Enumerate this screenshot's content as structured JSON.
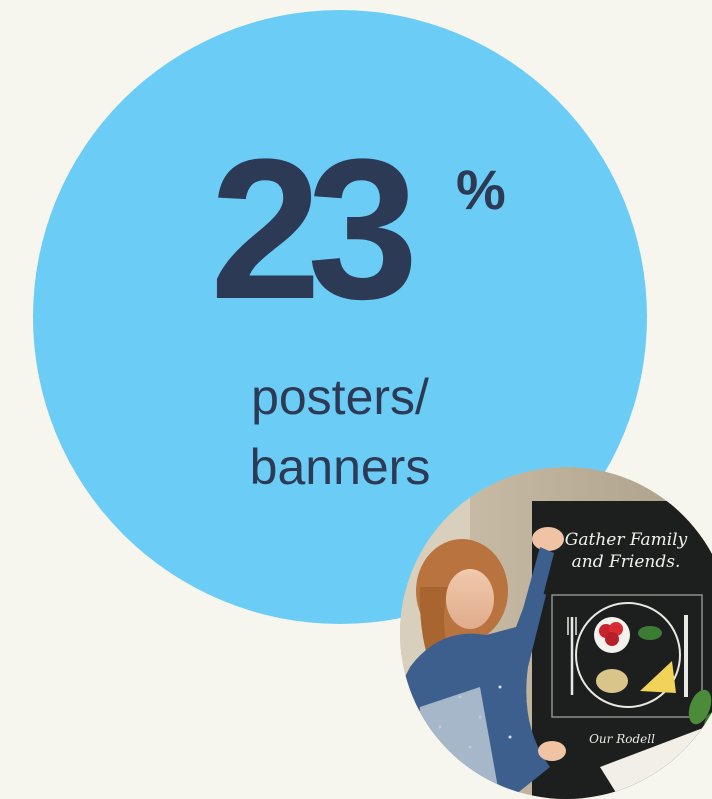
{
  "stat": {
    "value": "23",
    "unit": "%",
    "label_line1": "posters/",
    "label_line2": "banners"
  },
  "photo": {
    "poster_line1": "Gather Family",
    "poster_line2": "and Friends.",
    "poster_footer": "Our Rodell"
  },
  "colors": {
    "background": "#f6f5ee",
    "circle": "#6bcdf5",
    "text": "#2c3a55"
  }
}
